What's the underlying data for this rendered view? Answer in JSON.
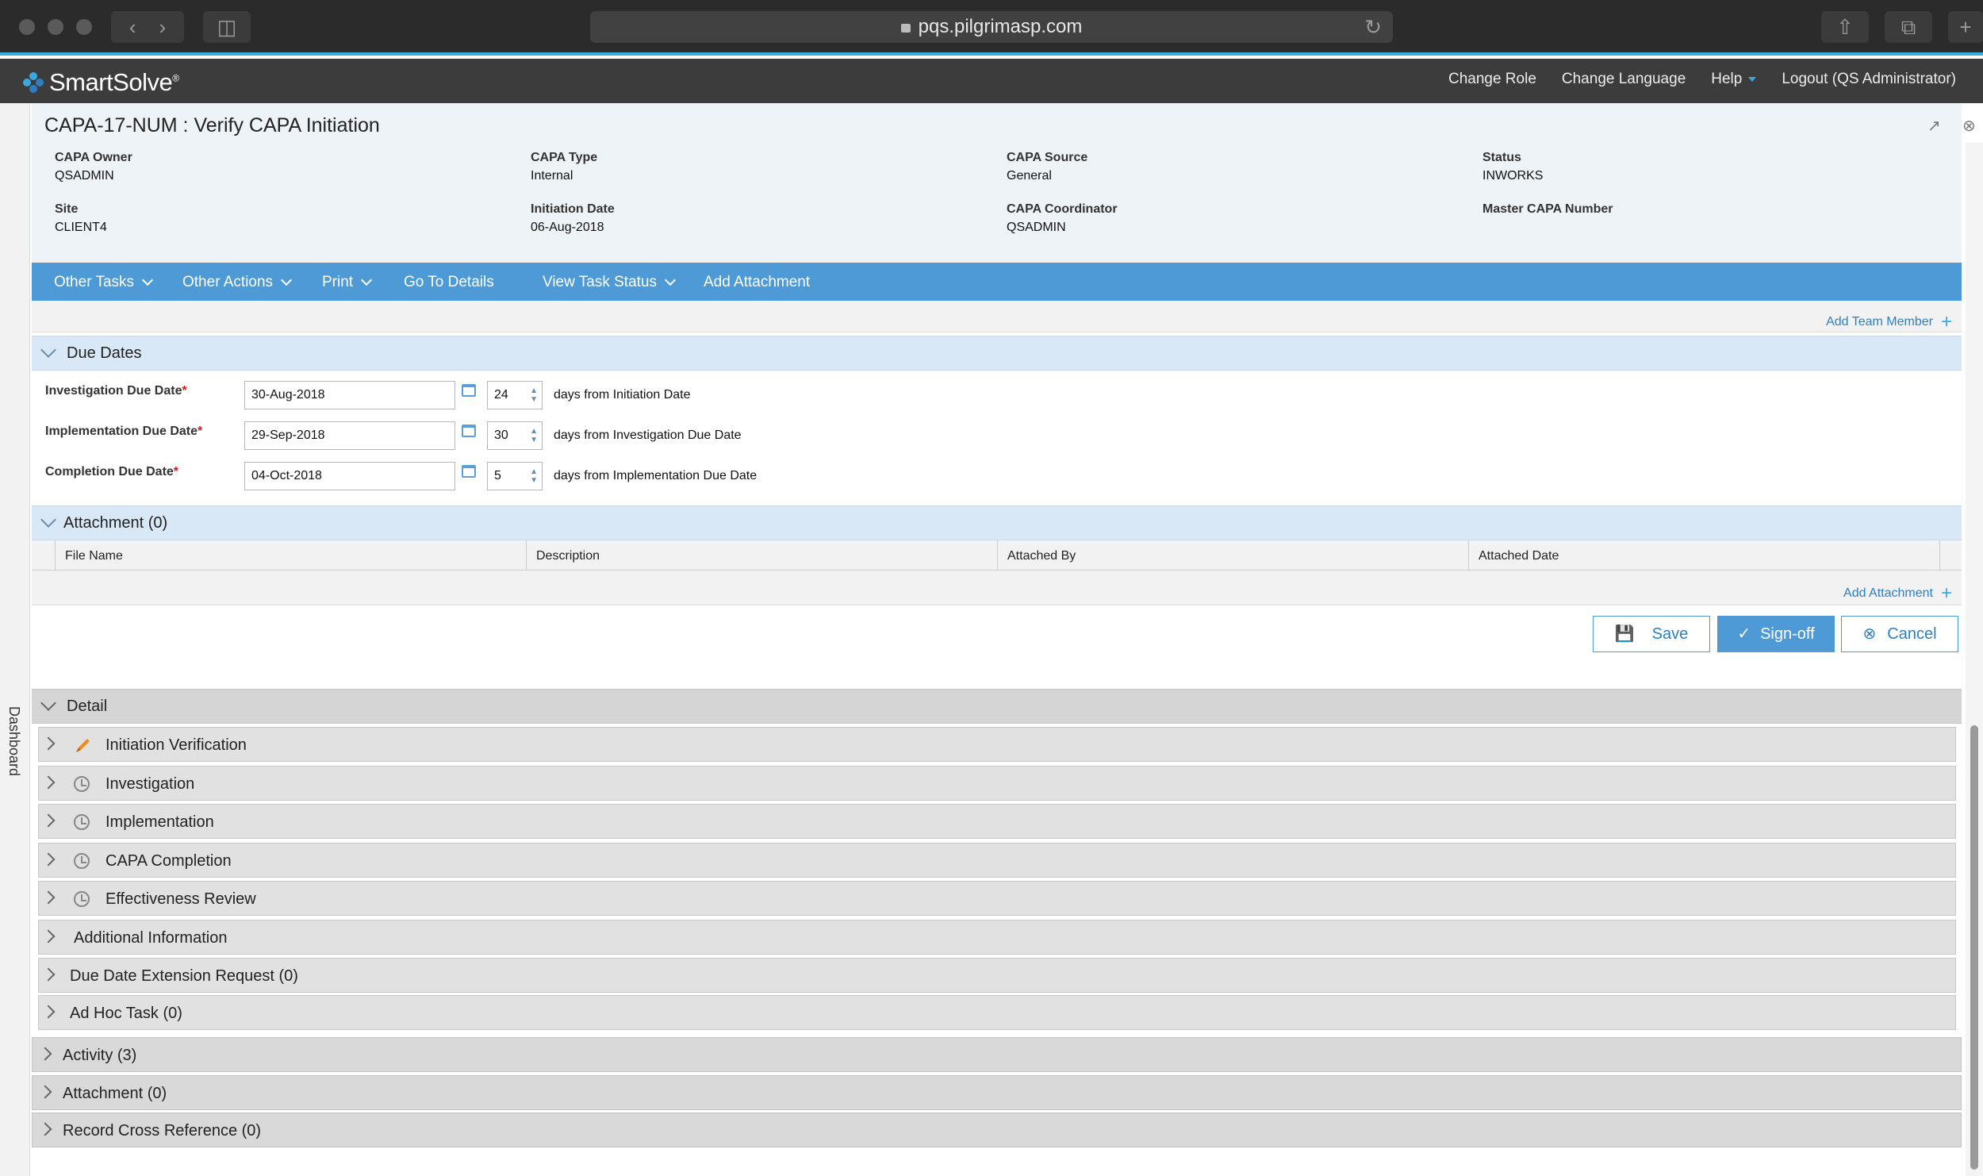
{
  "browser": {
    "url": "pqs.pilgrimasp.com"
  },
  "app": {
    "logo_text": "SmartSolve",
    "logo_mark": "®",
    "nav": {
      "change_role": "Change Role",
      "change_language": "Change Language",
      "help": "Help",
      "logout": "Logout (QS Administrator)"
    },
    "side_tab": "Dashboard"
  },
  "record": {
    "title": "CAPA-17-NUM : Verify CAPA Initiation",
    "fields": {
      "capa_owner_label": "CAPA Owner",
      "capa_owner": "QSADMIN",
      "capa_type_label": "CAPA Type",
      "capa_type": "Internal",
      "capa_source_label": "CAPA Source",
      "capa_source": "General",
      "status_label": "Status",
      "status": "INWORKS",
      "site_label": "Site",
      "site": "CLIENT4",
      "initiation_date_label": "Initiation Date",
      "initiation_date": "06-Aug-2018",
      "capa_coordinator_label": "CAPA Coordinator",
      "capa_coordinator": "QSADMIN",
      "master_capa_label": "Master CAPA Number",
      "master_capa": ""
    }
  },
  "action_bar": {
    "other_tasks": "Other Tasks",
    "other_actions": "Other Actions",
    "print": "Print",
    "go_to_details": "Go To Details",
    "view_task_status": "View Task Status",
    "add_attachment": "Add Attachment"
  },
  "team": {
    "add_team_member": "Add Team Member"
  },
  "due_dates": {
    "title": "Due Dates",
    "rows": [
      {
        "label": "Investigation Due Date",
        "date": "30-Aug-2018",
        "days": "24",
        "days_text": "days from Initiation Date"
      },
      {
        "label": "Implementation Due Date",
        "date": "29-Sep-2018",
        "days": "30",
        "days_text": "days from Investigation Due Date"
      },
      {
        "label": "Completion Due Date",
        "date": "04-Oct-2018",
        "days": "5",
        "days_text": "days from Implementation Due Date"
      }
    ],
    "required_mark": "*"
  },
  "attachment": {
    "title": "Attachment (0)",
    "columns": [
      "File Name",
      "Description",
      "Attached By",
      "Attached Date"
    ],
    "add_attachment": "Add Attachment"
  },
  "buttons": {
    "save": "Save",
    "signoff": "Sign-off",
    "cancel": "Cancel"
  },
  "detail": {
    "title": "Detail",
    "items": [
      {
        "label": "Initiation Verification",
        "icon": "pencil-icon"
      },
      {
        "label": "Investigation",
        "icon": "clock-icon"
      },
      {
        "label": "Implementation",
        "icon": "clock-icon"
      },
      {
        "label": "CAPA Completion",
        "icon": "clock-icon"
      },
      {
        "label": "Effectiveness Review",
        "icon": "clock-icon"
      },
      {
        "label": "Additional Information"
      },
      {
        "label": "Due Date Extension Request (0)"
      },
      {
        "label": "Ad Hoc Task (0)"
      }
    ]
  },
  "bottom_sections": [
    {
      "label": "Activity (3)"
    },
    {
      "label": "Attachment (0)"
    },
    {
      "label": "Record Cross Reference (0)"
    }
  ],
  "colors": {
    "accent": "#3aa9e0",
    "action_bar": "#4e9ad6",
    "section_header": "#d9e8f7",
    "required": "#d21a1a"
  }
}
